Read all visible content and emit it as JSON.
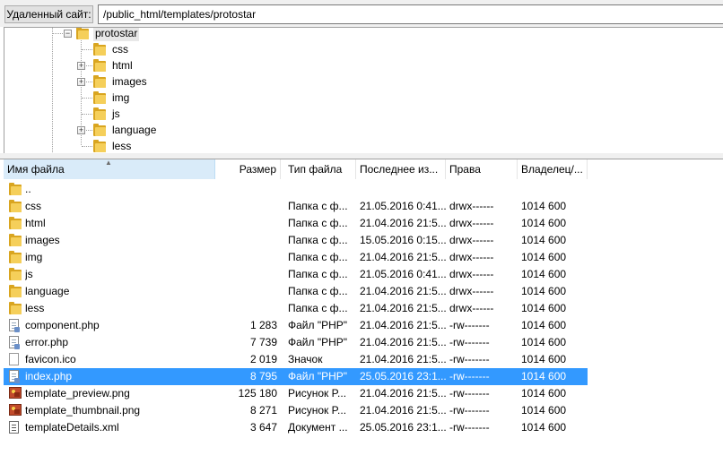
{
  "path_bar": {
    "label": "Удаленный сайт:",
    "path": "/public_html/templates/protostar"
  },
  "tree": {
    "root": {
      "label": "protostar",
      "expanded": true,
      "expander": "−"
    },
    "children": [
      {
        "label": "css",
        "has_children": false
      },
      {
        "label": "html",
        "has_children": true
      },
      {
        "label": "images",
        "has_children": true
      },
      {
        "label": "img",
        "has_children": false
      },
      {
        "label": "js",
        "has_children": false
      },
      {
        "label": "language",
        "has_children": true
      },
      {
        "label": "less",
        "has_children": false
      }
    ],
    "expander_collapsed": "+"
  },
  "columns": {
    "name": "Имя файла",
    "size": "Размер",
    "type": "Тип файла",
    "modified": "Последнее из...",
    "perms": "Права",
    "owner": "Владелец/..."
  },
  "files": [
    {
      "icon": "folder-icon",
      "name": "..",
      "size": "",
      "type": "",
      "modified": "",
      "perms": "",
      "owner": ""
    },
    {
      "icon": "folder-icon",
      "name": "css",
      "size": "",
      "type": "Папка с ф...",
      "modified": "21.05.2016 0:41...",
      "perms": "drwx------",
      "owner": "1014 600"
    },
    {
      "icon": "folder-icon",
      "name": "html",
      "size": "",
      "type": "Папка с ф...",
      "modified": "21.04.2016 21:5...",
      "perms": "drwx------",
      "owner": "1014 600"
    },
    {
      "icon": "folder-icon",
      "name": "images",
      "size": "",
      "type": "Папка с ф...",
      "modified": "15.05.2016 0:15...",
      "perms": "drwx------",
      "owner": "1014 600"
    },
    {
      "icon": "folder-icon",
      "name": "img",
      "size": "",
      "type": "Папка с ф...",
      "modified": "21.04.2016 21:5...",
      "perms": "drwx------",
      "owner": "1014 600"
    },
    {
      "icon": "folder-icon",
      "name": "js",
      "size": "",
      "type": "Папка с ф...",
      "modified": "21.05.2016 0:41...",
      "perms": "drwx------",
      "owner": "1014 600"
    },
    {
      "icon": "folder-icon",
      "name": "language",
      "size": "",
      "type": "Папка с ф...",
      "modified": "21.04.2016 21:5...",
      "perms": "drwx------",
      "owner": "1014 600"
    },
    {
      "icon": "folder-icon",
      "name": "less",
      "size": "",
      "type": "Папка с ф...",
      "modified": "21.04.2016 21:5...",
      "perms": "drwx------",
      "owner": "1014 600"
    },
    {
      "icon": "php-file-icon",
      "name": "component.php",
      "size": "1 283",
      "type": "Файл \"PHP\"",
      "modified": "21.04.2016 21:5...",
      "perms": "-rw-------",
      "owner": "1014 600"
    },
    {
      "icon": "php-file-icon",
      "name": "error.php",
      "size": "7 739",
      "type": "Файл \"PHP\"",
      "modified": "21.04.2016 21:5...",
      "perms": "-rw-------",
      "owner": "1014 600"
    },
    {
      "icon": "ico-file-icon",
      "name": "favicon.ico",
      "size": "2 019",
      "type": "Значок",
      "modified": "21.04.2016 21:5...",
      "perms": "-rw-------",
      "owner": "1014 600"
    },
    {
      "icon": "php-file-icon",
      "name": "index.php",
      "size": "8 795",
      "type": "Файл \"PHP\"",
      "modified": "25.05.2016 23:1...",
      "perms": "-rw-------",
      "owner": "1014 600",
      "selected": true
    },
    {
      "icon": "image-file-icon",
      "name": "template_preview.png",
      "size": "125 180",
      "type": "Рисунок P...",
      "modified": "21.04.2016 21:5...",
      "perms": "-rw-------",
      "owner": "1014 600"
    },
    {
      "icon": "image-file-icon",
      "name": "template_thumbnail.png",
      "size": "8 271",
      "type": "Рисунок P...",
      "modified": "21.04.2016 21:5...",
      "perms": "-rw-------",
      "owner": "1014 600"
    },
    {
      "icon": "xml-file-icon",
      "name": "templateDetails.xml",
      "size": "3 647",
      "type": "Документ ...",
      "modified": "25.05.2016 23:1...",
      "perms": "-rw-------",
      "owner": "1014 600"
    }
  ],
  "colors": {
    "selection": "#3399ff",
    "sorted_header": "#d9ebf9",
    "folder": "#f5cf5a"
  }
}
